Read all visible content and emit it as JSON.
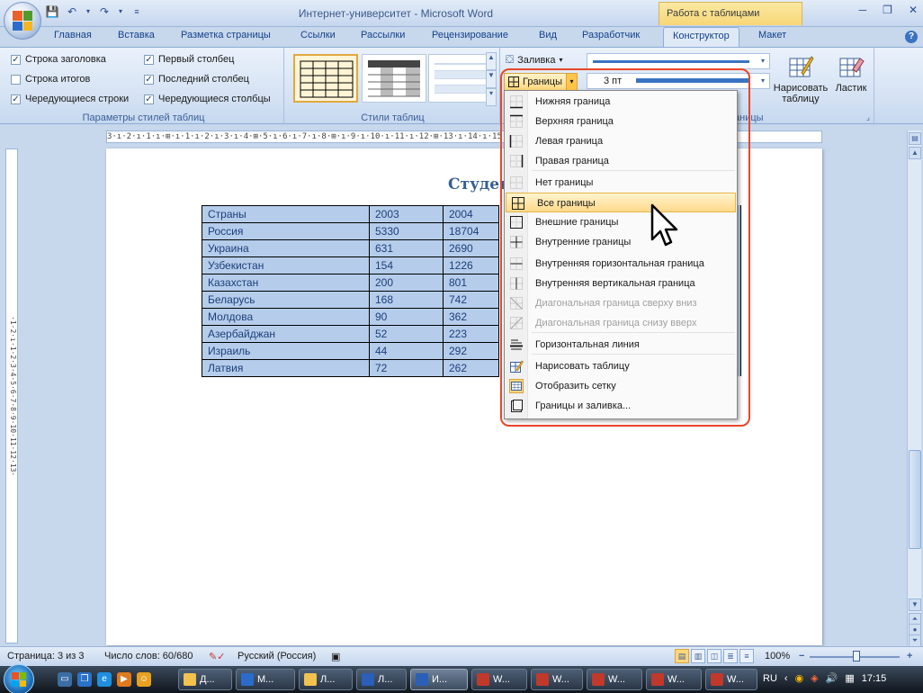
{
  "window": {
    "title": "Интернет-университет - Microsoft Word",
    "context_group": "Работа с таблицами"
  },
  "tabs": [
    "Главная",
    "Вставка",
    "Разметка страницы",
    "Ссылки",
    "Рассылки",
    "Рецензирование",
    "Вид",
    "Разработчик",
    "Конструктор",
    "Макет"
  ],
  "active_tab": "Конструктор",
  "ribbon": {
    "style_options": {
      "label": "Параметры стилей таблиц",
      "checks": [
        {
          "label": "Строка заголовка",
          "checked": true
        },
        {
          "label": "Первый столбец",
          "checked": true
        },
        {
          "label": "Строка итогов",
          "checked": false
        },
        {
          "label": "Последний столбец",
          "checked": true
        },
        {
          "label": "Чередующиеся строки",
          "checked": true
        },
        {
          "label": "Чередующиеся столбцы",
          "checked": true
        }
      ]
    },
    "table_styles": {
      "label": "Стили таблиц"
    },
    "fill_label": "Заливка",
    "borders_label": "Границы",
    "pen_weight": "3 пт",
    "draw_group_label_partial": "аницы",
    "draw_table_label": "Нарисовать таблицу",
    "eraser_label": "Ластик"
  },
  "borders_menu": {
    "items": [
      {
        "label": "Нижняя граница",
        "disabled": false,
        "icon": "border-bottom-icon"
      },
      {
        "label": "Верхняя граница",
        "disabled": false,
        "icon": "border-top-icon"
      },
      {
        "label": "Левая граница",
        "disabled": false,
        "icon": "border-left-icon"
      },
      {
        "label": "Правая граница",
        "disabled": false,
        "icon": "border-right-icon"
      },
      {
        "label": "Нет границы",
        "disabled": false,
        "icon": "border-none-icon"
      },
      {
        "label": "Все границы",
        "disabled": false,
        "icon": "border-all-icon",
        "highlighted": true
      },
      {
        "label": "Внешние границы",
        "disabled": false,
        "icon": "border-outside-icon"
      },
      {
        "label": "Внутренние границы",
        "disabled": false,
        "icon": "border-inside-icon"
      },
      {
        "label": "Внутренняя горизонтальная граница",
        "disabled": false,
        "icon": "border-inside-horizontal-icon"
      },
      {
        "label": "Внутренняя вертикальная граница",
        "disabled": false,
        "icon": "border-inside-vertical-icon"
      },
      {
        "label": "Диагональная граница сверху вниз",
        "disabled": true,
        "icon": "diagonal-down-icon"
      },
      {
        "label": "Диагональная граница снизу вверх",
        "disabled": true,
        "icon": "diagonal-up-icon"
      },
      {
        "label": "Горизонтальная линия",
        "disabled": false,
        "icon": "horizontal-line-icon"
      },
      {
        "label": "Нарисовать таблицу",
        "disabled": false,
        "icon": "draw-table-icon"
      },
      {
        "label": "Отобразить сетку",
        "disabled": false,
        "icon": "show-grid-icon"
      },
      {
        "label": "Границы и заливка...",
        "disabled": false,
        "icon": "borders-shading-icon"
      }
    ]
  },
  "document": {
    "heading_partial": "Студен",
    "table": [
      [
        "Страны",
        "2003",
        "2004"
      ],
      [
        "Россия",
        "5330",
        "18704"
      ],
      [
        "Украина",
        "631",
        "2690"
      ],
      [
        "Узбекистан",
        "154",
        "1226"
      ],
      [
        "Казахстан",
        "200",
        "801"
      ],
      [
        "Беларусь",
        "168",
        "742"
      ],
      [
        "Молдова",
        "90",
        "362"
      ],
      [
        "Азербайджан",
        "52",
        "223"
      ],
      [
        "Израиль",
        "44",
        "292"
      ],
      [
        "Латвия",
        "72",
        "262"
      ]
    ]
  },
  "ruler": {
    "h_text": "3·ı·2·ı·1·ı·⊞·ı·1·ı·2·ı·3·ı·4·⊞·5·ı·6·ı·7·ı·8·⊞·ı·9·ı·10·ı·11·ı·12·⊞·13·ı·14·ı·15·⊞16·ı·17·ı·18",
    "v_text": "·1·2·ı·1·2·3·4·5·6·7·8·9·10·11·12·13·"
  },
  "status": {
    "page": "Страница: 3 из 3",
    "words": "Число слов: 60/680",
    "language": "Русский (Россия)",
    "zoom": "100%"
  },
  "taskbar": {
    "tasks": [
      {
        "label": "Д...",
        "icon": "folder"
      },
      {
        "label": "M...",
        "icon": "outlook"
      },
      {
        "label": "Л...",
        "icon": "folder"
      },
      {
        "label": "Л...",
        "icon": "word"
      },
      {
        "label": "И...",
        "icon": "word",
        "active": true
      },
      {
        "label": "W...",
        "icon": "app"
      },
      {
        "label": "W...",
        "icon": "app"
      },
      {
        "label": "W...",
        "icon": "app"
      },
      {
        "label": "W...",
        "icon": "app"
      },
      {
        "label": "W...",
        "icon": "app"
      }
    ],
    "lang": "RU",
    "clock": "17:15"
  },
  "colors": {
    "accent_blue": "#15428b",
    "highlight_outline": "#e8462a",
    "table_selection": "#b5cdeb",
    "menu_hot": "#ffd98a"
  }
}
